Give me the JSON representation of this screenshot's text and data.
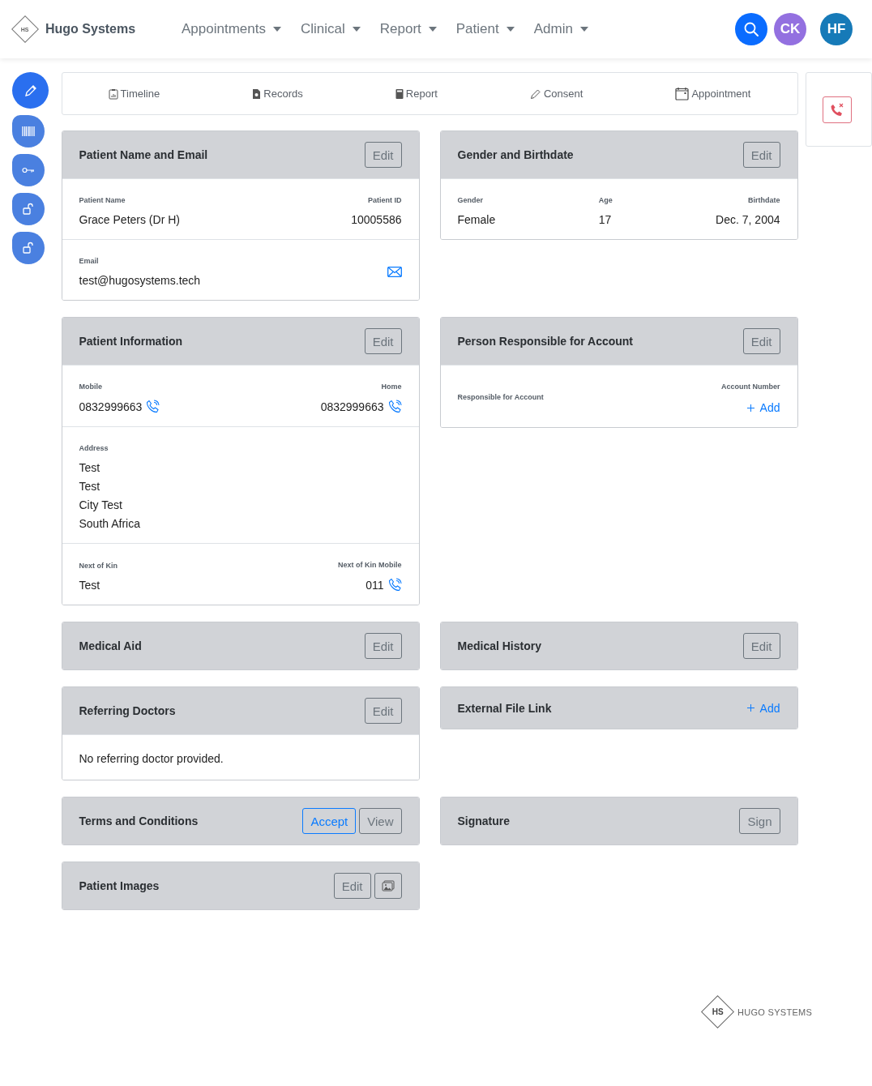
{
  "brand": {
    "mark": "HS",
    "name": "Hugo Systems"
  },
  "nav": [
    {
      "label": "Appointments"
    },
    {
      "label": "Clinical"
    },
    {
      "label": "Report"
    },
    {
      "label": "Patient"
    },
    {
      "label": "Admin"
    }
  ],
  "header_actions": [
    {
      "kind": "search"
    },
    {
      "kind": "avatar",
      "initials": "CK",
      "color": "#9370e0"
    },
    {
      "kind": "avatar",
      "initials": "HF",
      "color": "#167ab8"
    }
  ],
  "side_buttons": [
    {
      "kind": "pencil"
    },
    {
      "kind": "barcode"
    },
    {
      "kind": "key"
    },
    {
      "kind": "unlock"
    },
    {
      "kind": "unlock"
    }
  ],
  "tabs": [
    {
      "label": "Timeline",
      "kind": "timeline"
    },
    {
      "label": "Records",
      "kind": "records"
    },
    {
      "label": "Report",
      "kind": "report"
    },
    {
      "label": "Consent",
      "kind": "consent"
    },
    {
      "label": "Appointment",
      "kind": "appointment"
    }
  ],
  "rows": [
    [
      {
        "title": "Patient Name and Email",
        "actions": [
          {
            "kind": "edit",
            "label": "Edit"
          }
        ],
        "sections": [
          [
            {
              "kind": "field",
              "label": "Patient Name",
              "lines": [
                "Grace Peters (Dr H)"
              ]
            },
            {
              "kind": "field",
              "label": "Patient ID",
              "lines": [
                "10005586"
              ]
            }
          ],
          [
            {
              "kind": "field",
              "label": "Email",
              "lines": [
                "test@hugosystems.tech"
              ]
            },
            {
              "kind": "email-action"
            }
          ]
        ]
      },
      {
        "title": "Gender and Birthdate",
        "actions": [
          {
            "kind": "edit",
            "label": "Edit"
          }
        ],
        "sections": [
          [
            {
              "kind": "field",
              "label": "Gender",
              "lines": [
                "Female"
              ]
            },
            {
              "kind": "field",
              "label": "Age",
              "lines": [
                "17"
              ]
            },
            {
              "kind": "field",
              "label": "Birthdate",
              "lines": [
                "Dec. 7, 2004"
              ]
            }
          ]
        ]
      }
    ],
    [
      {
        "title": "Patient Information",
        "actions": [
          {
            "kind": "edit",
            "label": "Edit"
          }
        ],
        "sections": [
          [
            {
              "kind": "field",
              "label": "Mobile",
              "lines": [
                "0832999663"
              ],
              "callable": true
            },
            {
              "kind": "field",
              "label": "Home",
              "lines": [
                "0832999663"
              ],
              "callable": true
            }
          ],
          [
            {
              "kind": "field",
              "label": "Address",
              "lines": [
                "Test",
                "Test",
                "City Test",
                "South Africa"
              ]
            }
          ],
          [
            {
              "kind": "field",
              "label": "Next of Kin",
              "lines": [
                "Test"
              ]
            },
            {
              "kind": "field",
              "label": "Next of Kin Mobile",
              "lines": [
                "011"
              ],
              "callable": true
            }
          ]
        ]
      },
      {
        "title": "Person Responsible for Account",
        "actions": [
          {
            "kind": "edit",
            "label": "Edit"
          }
        ],
        "sections": [
          [
            {
              "kind": "field",
              "label": "Responsible for Account"
            },
            {
              "kind": "add-field",
              "label": "Account Number",
              "link": "Add"
            }
          ]
        ]
      }
    ],
    [
      {
        "title": "Medical Aid",
        "actions": [
          {
            "kind": "edit",
            "label": "Edit"
          }
        ]
      },
      {
        "title": "Medical History",
        "actions": [
          {
            "kind": "edit",
            "label": "Edit"
          }
        ]
      }
    ],
    [
      {
        "title": "Referring Doctors",
        "actions": [
          {
            "kind": "edit",
            "label": "Edit"
          }
        ],
        "sections": [
          [
            {
              "kind": "note",
              "lines": [
                "No referring doctor provided."
              ]
            }
          ]
        ]
      },
      {
        "title": "External File Link",
        "actions": [
          {
            "kind": "add",
            "label": "Add"
          }
        ]
      }
    ],
    [
      {
        "title": "Terms and Conditions",
        "actions": [
          {
            "kind": "accept",
            "label": "Accept"
          },
          {
            "kind": "edit",
            "label": "View"
          }
        ]
      },
      {
        "title": "Signature",
        "actions": [
          {
            "kind": "edit",
            "label": "Sign"
          }
        ]
      }
    ],
    [
      {
        "title": "Patient Images",
        "actions": [
          {
            "kind": "edit",
            "label": "Edit"
          },
          {
            "kind": "gallery"
          }
        ]
      }
    ]
  ],
  "footer": {
    "mark": "HS",
    "name": "HUGO SYSTEMS"
  }
}
